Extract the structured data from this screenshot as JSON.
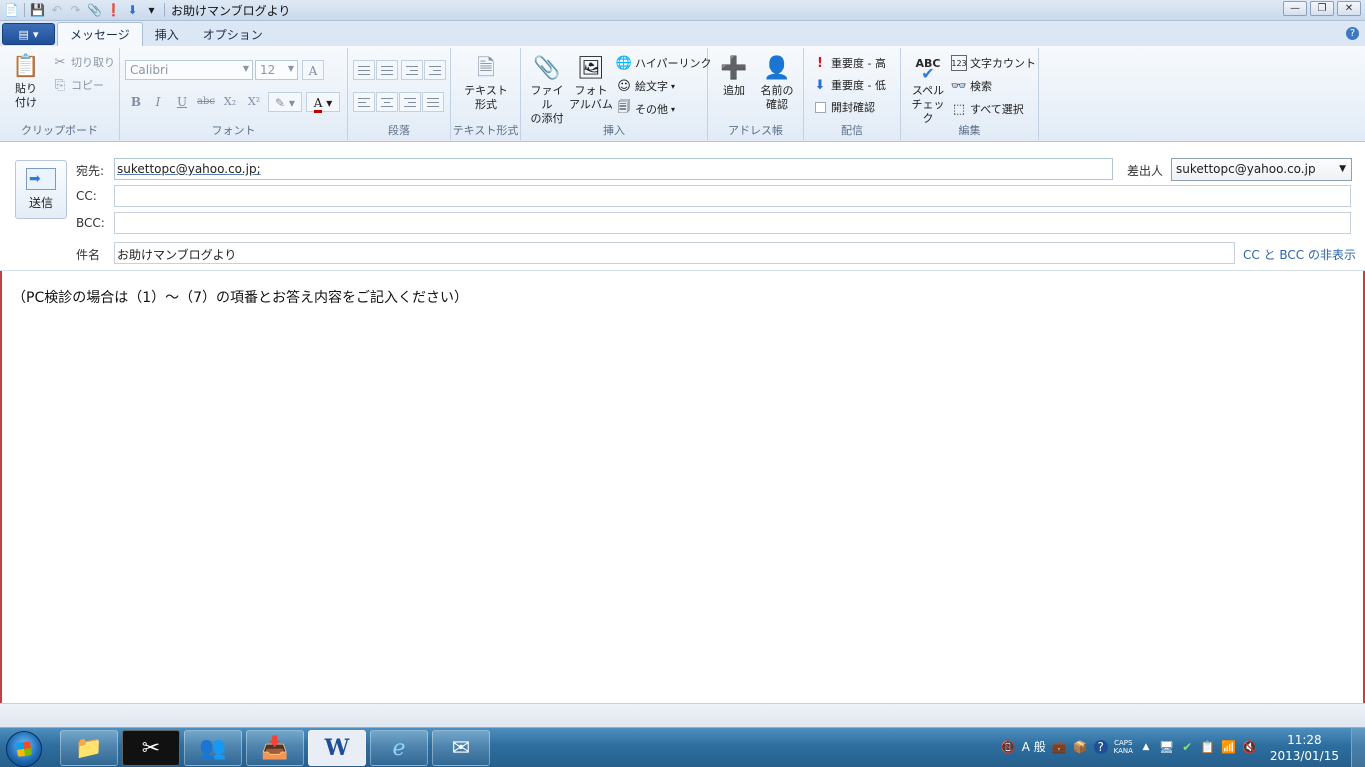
{
  "window": {
    "title": "お助けマンブログより",
    "controls": [
      "—",
      "❐",
      "✕"
    ]
  },
  "quick_access": [
    "📄",
    "💾",
    "↶",
    "↷",
    "📎",
    "❗",
    "⬇",
    "▾"
  ],
  "tabs": [
    "メッセージ",
    "挿入",
    "オプション"
  ],
  "ribbon": {
    "clipboard": {
      "label": "クリップボード",
      "paste": "貼り\n付け",
      "cut": "切り取り",
      "copy": "コピー"
    },
    "font": {
      "label": "フォント",
      "family": "Calibri",
      "size": "12"
    },
    "paragraph": {
      "label": "段落"
    },
    "textformat": {
      "label": "テキスト形式",
      "button": "テキスト\n形式"
    },
    "insert": {
      "label": "挿入",
      "attach": "ファイル\nの添付",
      "photo": "フォト\nアルバム",
      "hyperlink": "ハイパーリンク",
      "emoji": "絵文字",
      "other": "その他"
    },
    "addressbook": {
      "label": "アドレス帳",
      "add": "追加",
      "check_names": "名前の\n確認"
    },
    "delivery": {
      "label": "配信",
      "high": "重要度 - 高",
      "low": "重要度 - 低",
      "read_receipt": "開封確認"
    },
    "edit": {
      "label": "編集",
      "spell": "スペル\nチェック",
      "wordcount": "文字カウント",
      "find": "検索",
      "select_all": "すべて選択"
    }
  },
  "header": {
    "send": "送信",
    "to_label": "宛先:",
    "to_value": "sukettopc@yahoo.co.jp;",
    "cc_label": "CC:",
    "bcc_label": "BCC:",
    "subject_label": "件名",
    "subject_value": "お助けマンブログより",
    "from_label": "差出人",
    "from_value": "sukettopc@yahoo.co.jp",
    "cc_toggle": "CC と BCC の非表示"
  },
  "body_text": "（PC検診の場合は（1）～（7）の項番とお答え内容をご記入ください）",
  "taskbar": {
    "apps": [
      "📁",
      "✂",
      "👥",
      "📥",
      "W",
      "e",
      "✉"
    ],
    "tray": [
      "📵",
      "A 般",
      "💼",
      "📦",
      "?",
      "▲",
      "🖥",
      "✔",
      "📋",
      "📶",
      "🔇"
    ],
    "caps": "CAPS",
    "kana": "KANA",
    "time": "11:28",
    "date": "2013/01/15"
  },
  "colors": {
    "accent": "#2c64a8",
    "window_border": "#c14141",
    "taskbar": "#2d6e9f"
  }
}
